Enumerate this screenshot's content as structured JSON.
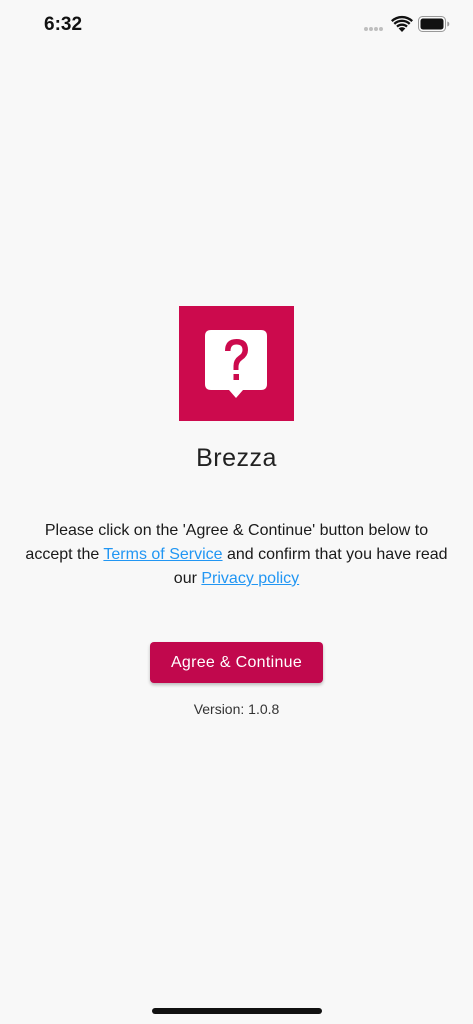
{
  "status_bar": {
    "time": "6:32",
    "icons": [
      "signal-dots-icon",
      "wifi-icon",
      "battery-icon"
    ]
  },
  "app": {
    "name": "Brezza",
    "logo_icon": "question-bubble-icon",
    "brand_color": "#cc0a4d"
  },
  "consent": {
    "text_before_terms": "Please click on the 'Agree & Continue' button below to accept the ",
    "terms_link": "Terms of Service",
    "text_between": " and confirm that you have read our ",
    "privacy_link": "Privacy policy",
    "link_color": "#2196f3"
  },
  "actions": {
    "agree_label": "Agree & Continue",
    "button_color": "#c1084d"
  },
  "footer": {
    "version": "Version: 1.0.8"
  }
}
